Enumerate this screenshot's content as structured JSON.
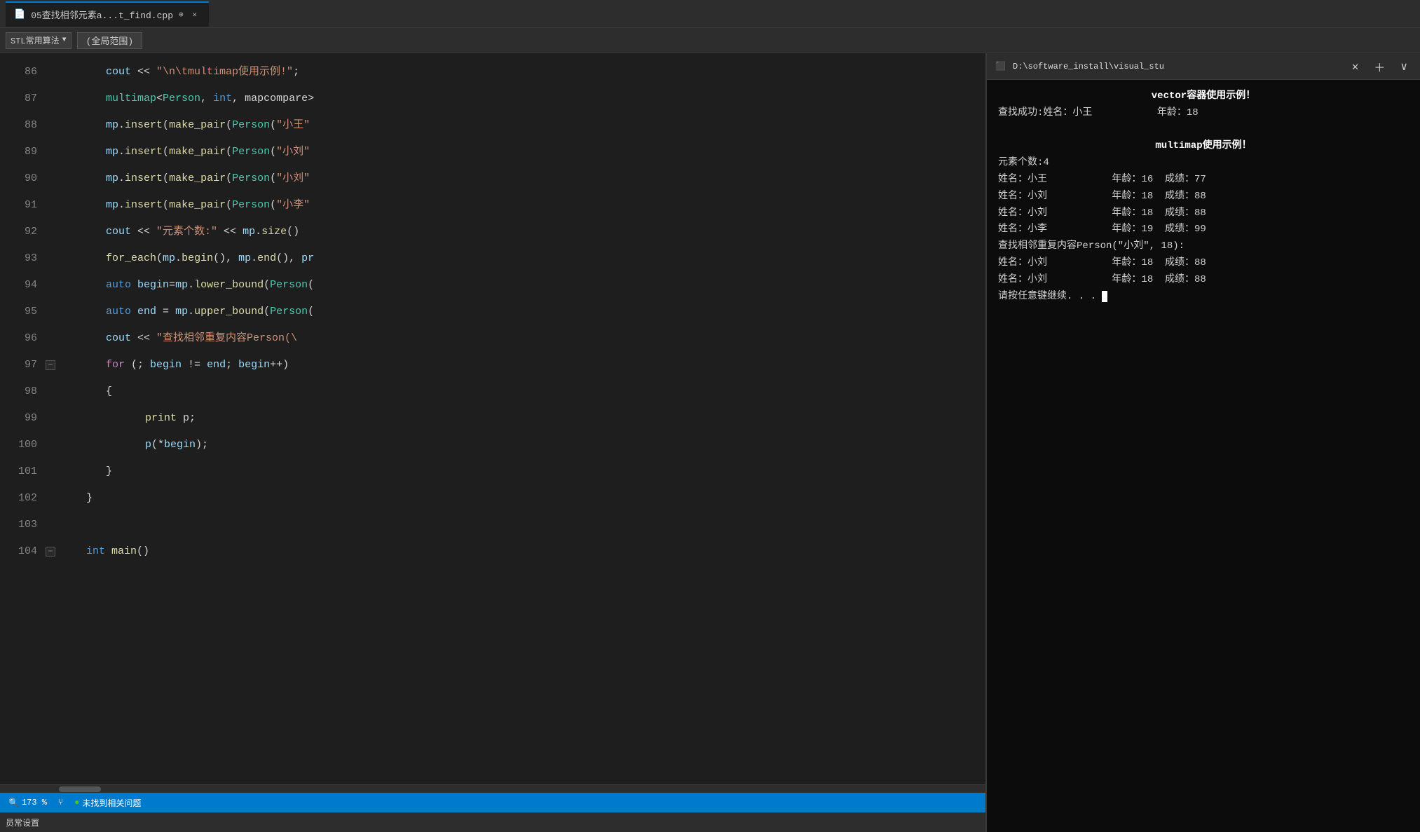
{
  "titleBar": {
    "tab": {
      "name": "05查找相邻元素a...t_find.cpp",
      "icon": "📄"
    }
  },
  "toolbar": {
    "dropdown": "STL常用算法",
    "scope": "(全局范围)"
  },
  "editor": {
    "lines": [
      {
        "num": 86,
        "content": "cout_multimap",
        "indent": 2
      },
      {
        "num": 87,
        "content": "multimap_decl",
        "indent": 2
      },
      {
        "num": 88,
        "content": "mp_insert_1",
        "indent": 2
      },
      {
        "num": 89,
        "content": "mp_insert_2",
        "indent": 2
      },
      {
        "num": 90,
        "content": "mp_insert_3",
        "indent": 2
      },
      {
        "num": 91,
        "content": "mp_insert_4",
        "indent": 2
      },
      {
        "num": 92,
        "content": "cout_count",
        "indent": 2
      },
      {
        "num": 93,
        "content": "for_each",
        "indent": 2
      },
      {
        "num": 94,
        "content": "auto_begin",
        "indent": 2
      },
      {
        "num": 95,
        "content": "auto_end",
        "indent": 2
      },
      {
        "num": 96,
        "content": "cout_find",
        "indent": 2
      },
      {
        "num": 97,
        "content": "for_loop",
        "indent": 2
      },
      {
        "num": 98,
        "content": "brace_open",
        "indent": 2
      },
      {
        "num": 99,
        "content": "print_p",
        "indent": 3
      },
      {
        "num": 100,
        "content": "p_begin",
        "indent": 3
      },
      {
        "num": 101,
        "content": "brace_close",
        "indent": 2
      },
      {
        "num": 102,
        "content": "outer_brace_close",
        "indent": 1
      },
      {
        "num": 103,
        "content": "empty",
        "indent": 0
      },
      {
        "num": 104,
        "content": "int_main",
        "indent": 1
      }
    ]
  },
  "terminal": {
    "titlePath": "D:\\software_install\\visual_stu",
    "output": [
      {
        "text": "vector容器使用示例！",
        "bold": true
      },
      {
        "text": "查找成功:姓名：小王           年龄：18"
      },
      {
        "text": ""
      },
      {
        "text": "multimap使用示例！",
        "bold": true
      },
      {
        "text": "元素个数:4"
      },
      {
        "text": "姓名：小王           年龄：16  成绩：77"
      },
      {
        "text": "姓名：小刘           年龄：18  成绩：88"
      },
      {
        "text": "姓名：小刘           年龄：18  成绩：88"
      },
      {
        "text": "姓名：小李           年龄：19  成绩：99"
      },
      {
        "text": "查找相邻重复内容Person(\"小刘\", 18):"
      },
      {
        "text": "姓名：小刘           年龄：18  成绩：88"
      },
      {
        "text": "姓名：小刘           年龄：18  成绩：88"
      },
      {
        "text": "请按任意键继续. . .",
        "cursor": true
      }
    ]
  },
  "statusBar": {
    "zoom": "173 %",
    "noProblems": "未找到相关问题"
  },
  "bottomBar": {
    "label": "员常设置"
  }
}
